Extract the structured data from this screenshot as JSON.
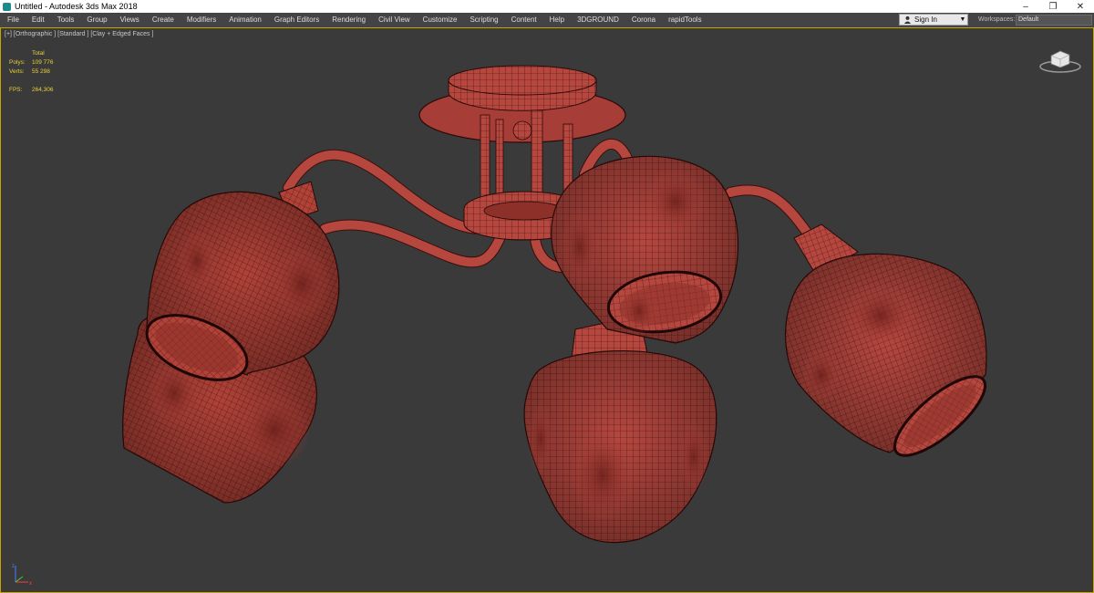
{
  "window": {
    "title": "Untitled - Autodesk 3ds Max 2018",
    "buttons": {
      "minimize": "–",
      "restore": "❐",
      "close": "✕"
    }
  },
  "menu": [
    "File",
    "Edit",
    "Tools",
    "Group",
    "Views",
    "Create",
    "Modifiers",
    "Animation",
    "Graph Editors",
    "Rendering",
    "Civil View",
    "Customize",
    "Scripting",
    "Content",
    "Help",
    "3DGROUND",
    "Corona",
    "rapidTools"
  ],
  "account": {
    "sign_in": "Sign In",
    "dropdown_arrow": "▼"
  },
  "workspaces": {
    "label": "Workspaces:",
    "value": "Default"
  },
  "viewport": {
    "label": "[+] [Orthographic ] [Standard ] [Clay + Edged Faces ]",
    "stats": {
      "header": "Total",
      "polys_label": "Polys:",
      "polys_value": "109 776",
      "verts_label": "Verts:",
      "verts_value": "55 298",
      "fps_label": "FPS:",
      "fps_value": "264,306"
    },
    "axis_labels": {
      "x": "x",
      "z": "z"
    }
  },
  "colors": {
    "viewport_bg": "#3a3a3a",
    "model_clay": "#b5473f",
    "wire": "#3a0f0c",
    "active_border": "#c9a400",
    "stats_text": "#e8d23a"
  }
}
